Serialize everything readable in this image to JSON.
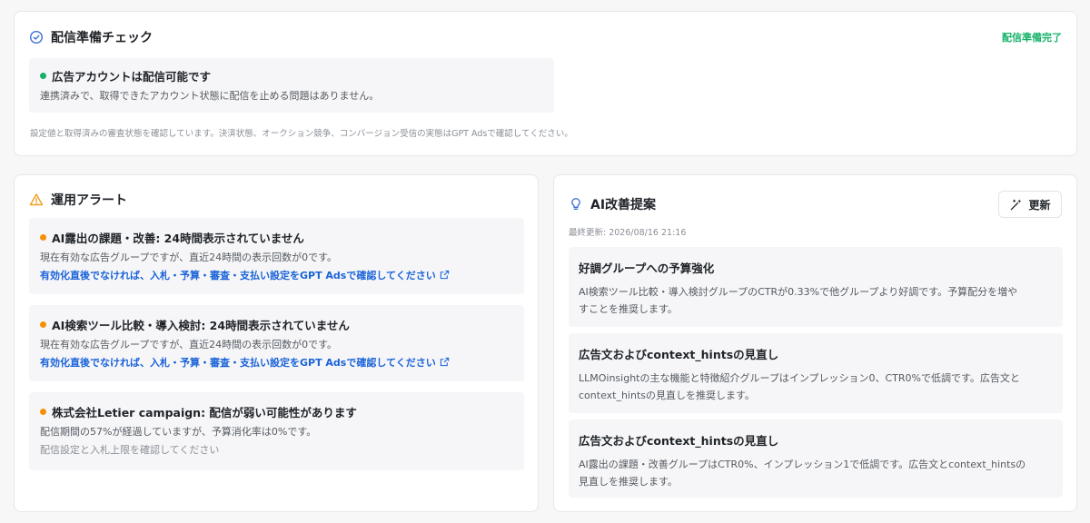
{
  "readiness": {
    "title": "配信準備チェック",
    "status": "配信準備完了",
    "box_title": "広告アカウントは配信可能です",
    "box_text": "連携済みで、取得できたアカウント状態に配信を止める問題はありません。",
    "footnote": "設定値と取得済みの審査状態を確認しています。決済状態、オークション競争、コンバージョン受信の実態はGPT Adsで確認してください。",
    "colors": {
      "ok": "#17b26a"
    }
  },
  "alerts": {
    "title": "運用アラート",
    "items": [
      {
        "title": "AI露出の課題・改善: 24時間表示されていません",
        "text": "現在有効な広告グループですが、直近24時間の表示回数が0です。",
        "link": "有効化直後でなければ、入札・予算・審査・支払い設定をGPT Adsで確認してください"
      },
      {
        "title": "AI検索ツール比較・導入検討: 24時間表示されていません",
        "text": "現在有効な広告グループですが、直近24時間の表示回数が0です。",
        "link": "有効化直後でなければ、入札・予算・審査・支払い設定をGPT Adsで確認してください"
      },
      {
        "title": "株式会社Letier campaign: 配信が弱い可能性があります",
        "text": "配信期間の57%が経過していますが、予算消化率は0%です。",
        "sub": "配信設定と入札上限を確認してください"
      }
    ],
    "colors": {
      "warning": "#f79009",
      "link": "#1a63d8"
    }
  },
  "ai": {
    "title": "AI改善提案",
    "refresh_label": "更新",
    "updated": "最終更新: 2026/08/16 21:16",
    "suggestions": [
      {
        "title": "好調グループへの予算強化",
        "text_line1": "AI検索ツール比較・導入検討グループのCTRが0.33%で他グループより好調です。予算配分を増や",
        "text_line2": "すことを推奨します。"
      },
      {
        "title": "広告文およびcontext_hintsの見直し",
        "text_line1": "LLMOinsightの主な機能と特徴紹介グループはインプレッション0、CTR0%で低調です。広告文と",
        "text_line2": "context_hintsの見直しを推奨します。"
      },
      {
        "title": "広告文およびcontext_hintsの見直し",
        "text_line1": "AI露出の課題・改善グループはCTR0%、インプレッション1で低調です。広告文とcontext_hintsの",
        "text_line2": "見直しを推奨します。"
      }
    ]
  },
  "icons": {
    "readiness": "check-circle-icon",
    "alerts": "warning-triangle-icon",
    "ai": "lightbulb-icon",
    "refresh": "magic-wand-icon",
    "external": "external-link-icon"
  }
}
